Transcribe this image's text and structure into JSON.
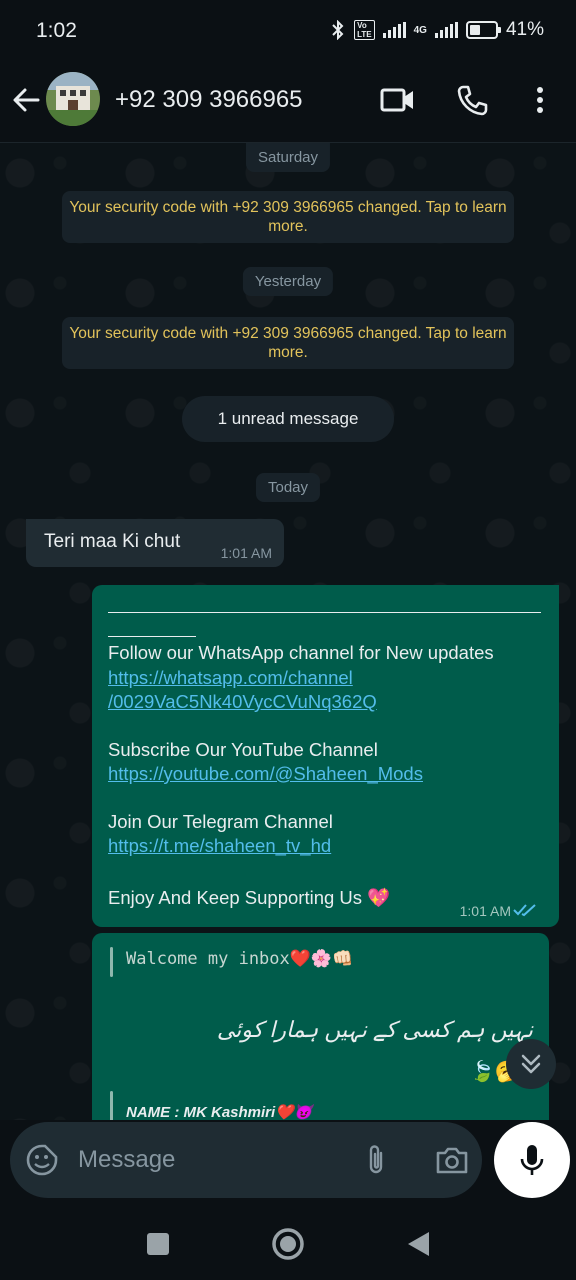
{
  "status": {
    "time": "1:02",
    "volte": "Vo LTE",
    "net": "4G",
    "battery": "41%"
  },
  "header": {
    "contact": "+92 309 3966965"
  },
  "chat": {
    "date1": "Saturday",
    "sys1": "Your security code with +92 309 3966965 changed. Tap to learn more.",
    "date2": "Yesterday",
    "sys2": "Your security code with +92 309 3966965 changed. Tap to learn more.",
    "unread": "1 unread message",
    "date3": "Today",
    "incoming": {
      "text": "Teri maa Ki chut",
      "time": "1:01 AM"
    },
    "outgoing": {
      "line1": "Follow our WhatsApp channel for New updates",
      "link1a": "https://whatsapp.com/channel",
      "link1b": "/0029VaC5Nk40VycCVuNq362Q",
      "line2": "Subscribe Our YouTube Channel",
      "link2": "https://youtube.com/@Shaheen_Mods",
      "line3": "Join Our Telegram Channel",
      "link3": "https://t.me/shaheen_tv_hd",
      "line4": "Enjoy And Keep Supporting Us 💖",
      "time": "1:01 AM"
    },
    "quoted": {
      "welcome": "Walcome my inbox❤️🌸👊🏻",
      "urdu": "نہیں ہم کسی کے نہیں ہمارا کوئی",
      "emoji": "🍃🥱",
      "name": "NAME : MK Kashmiri❤️😈"
    }
  },
  "composer": {
    "placeholder": "Message"
  },
  "colors": {
    "outgoing_bubble": "#005c4b",
    "system_text": "#e2c35b",
    "link": "#53bdeb"
  }
}
